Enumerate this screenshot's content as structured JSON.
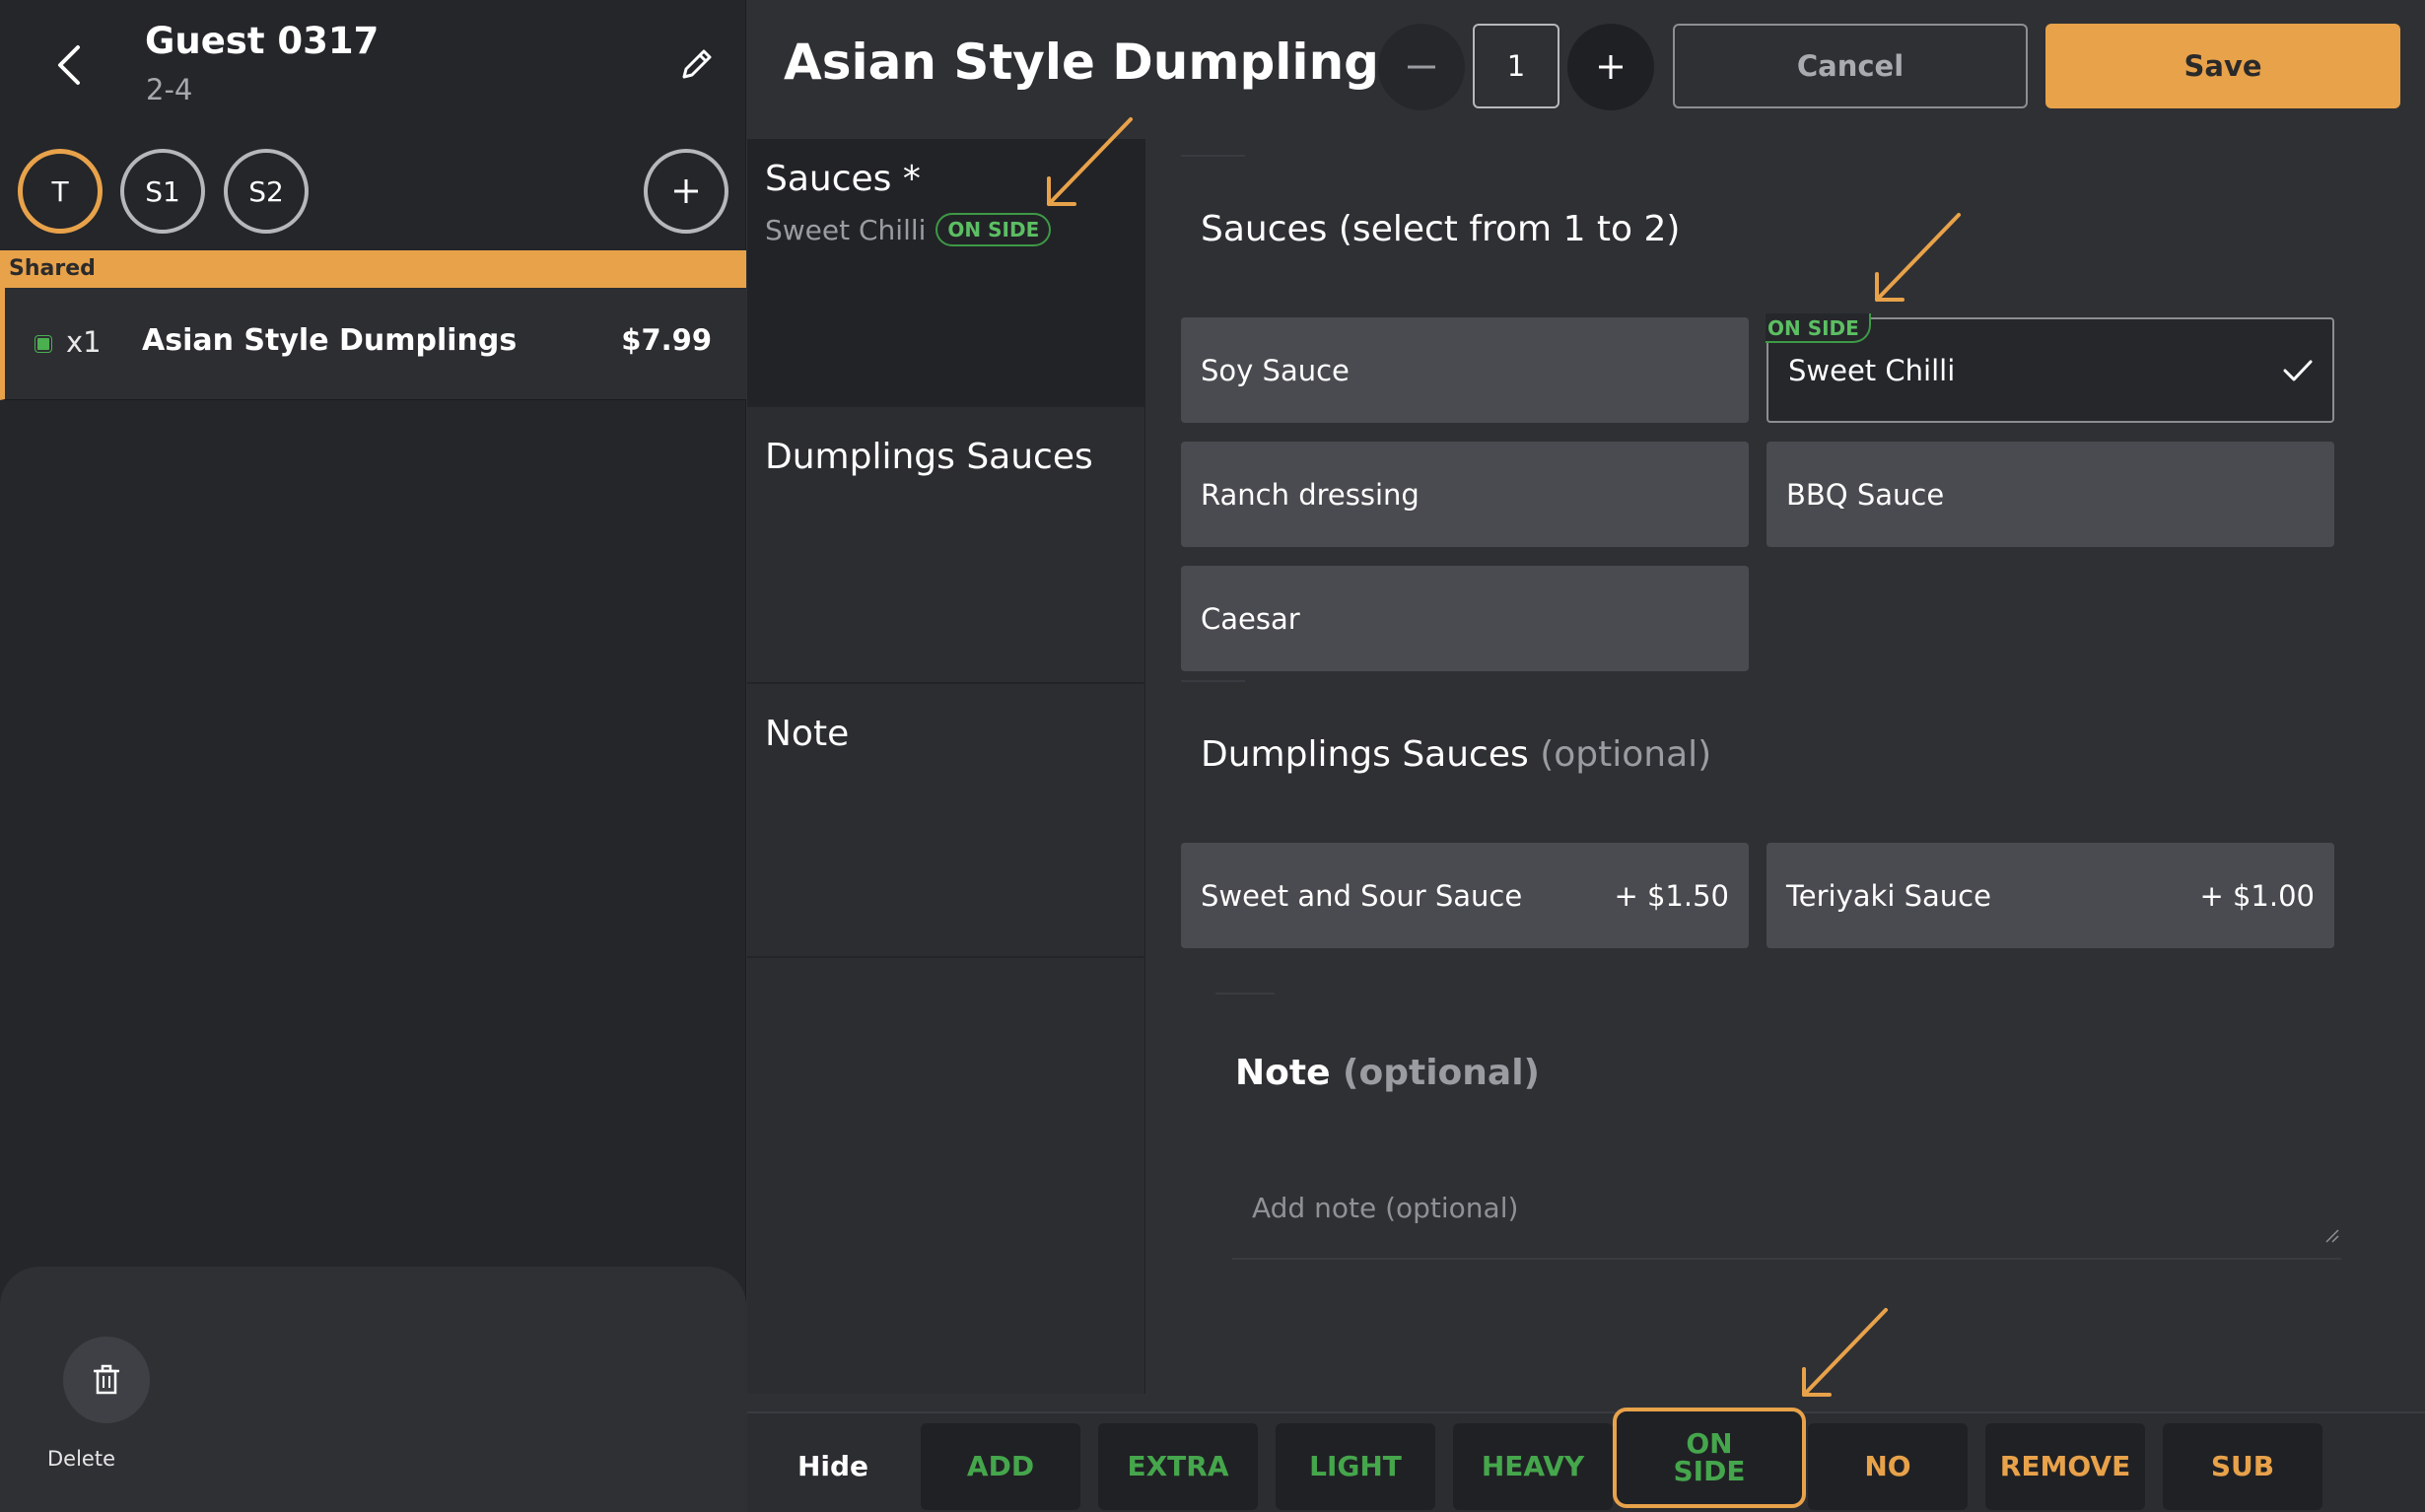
{
  "guest": {
    "name": "Guest 0317",
    "sub": "2-4"
  },
  "seats": [
    "T",
    "S1",
    "S2"
  ],
  "shared_label": "Shared",
  "order": {
    "qty": "x1",
    "name": "Asian Style Dumplings",
    "price": "$7.99"
  },
  "delete_label": "Delete",
  "item": {
    "title": "Asian Style Dumplings",
    "quantity": "1"
  },
  "actions": {
    "cancel": "Cancel",
    "save": "Save"
  },
  "categories": [
    {
      "title": "Sauces *",
      "selection": "Sweet Chilli",
      "badge": "ON SIDE"
    },
    {
      "title": "Dumplings Sauces"
    },
    {
      "title": "Note"
    }
  ],
  "sauces": {
    "title": "Sauces",
    "hint": "(select from 1 to 2)",
    "options": [
      "Soy Sauce",
      "Sweet Chilli",
      "Ranch dressing",
      "BBQ Sauce",
      "Caesar"
    ],
    "selected": "Sweet Chilli",
    "selected_tag": "ON SIDE"
  },
  "dumplings": {
    "title": "Dumplings Sauces",
    "hint": "(optional)",
    "options": [
      {
        "label": "Sweet and Sour Sauce",
        "price": "+ $1.50"
      },
      {
        "label": "Teriyaki Sauce",
        "price": "+ $1.00"
      }
    ]
  },
  "note": {
    "title": "Note",
    "hint": "(optional)",
    "placeholder": "Add note (optional)"
  },
  "modifiers": {
    "hide": "Hide",
    "buttons": [
      "ADD",
      "EXTRA",
      "LIGHT",
      "HEAVY",
      "ON SIDE",
      "NO",
      "REMOVE",
      "SUB"
    ],
    "highlighted": "ON SIDE"
  },
  "colors": {
    "accent": "#e8a24a",
    "green": "#45a64c",
    "bg": "#2f3034",
    "panel": "#24262a"
  },
  "icons": [
    "back-icon",
    "pencil-icon",
    "plus-icon",
    "minus-icon",
    "check-icon",
    "trash-icon",
    "arrow-annotation-icon"
  ]
}
